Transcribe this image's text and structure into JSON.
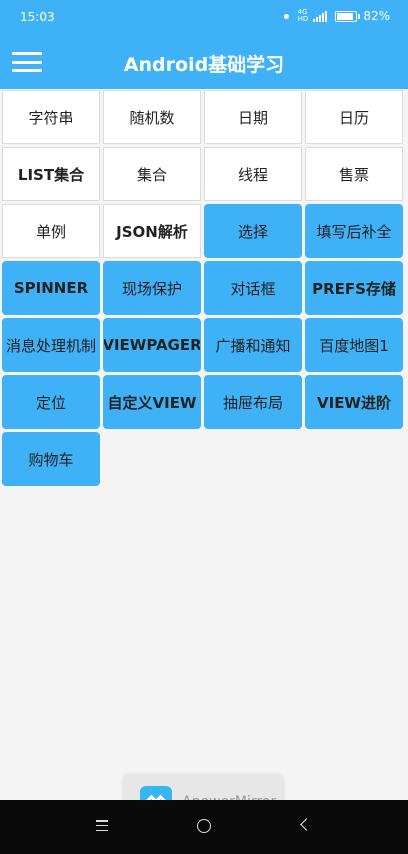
{
  "status_bar": {
    "time": "15:03",
    "network": "4G",
    "hd": "HD",
    "battery_level": "82%",
    "icons": [
      "notification-dot-icon",
      "signal-icon",
      "battery-icon"
    ]
  },
  "app_bar": {
    "title": "Android基础学习",
    "menu_icon": "hamburger-menu-icon",
    "color": "#3fb2f7"
  },
  "grid": {
    "rows": [
      [
        {
          "label": "字符串",
          "style": "white"
        },
        {
          "label": "随机数",
          "style": "white"
        },
        {
          "label": "日期",
          "style": "white"
        },
        {
          "label": "日历",
          "style": "white"
        }
      ],
      [
        {
          "label": "LIST集合",
          "style": "white"
        },
        {
          "label": "集合",
          "style": "white"
        },
        {
          "label": "线程",
          "style": "white"
        },
        {
          "label": "售票",
          "style": "white"
        }
      ],
      [
        {
          "label": "单例",
          "style": "white"
        },
        {
          "label": "JSON解析",
          "style": "white"
        },
        {
          "label": "选择",
          "style": "blue"
        },
        {
          "label": "填写后补全",
          "style": "blue"
        }
      ],
      [
        {
          "label": "SPINNER",
          "style": "blue"
        },
        {
          "label": "现场保护",
          "style": "blue"
        },
        {
          "label": "对话框",
          "style": "blue"
        },
        {
          "label": "PREFS存储",
          "style": "blue"
        }
      ],
      [
        {
          "label": "消息处理机制",
          "style": "blue"
        },
        {
          "label": "VIEWPAGER",
          "style": "blue"
        },
        {
          "label": "广播和通知",
          "style": "blue"
        },
        {
          "label": "百度地图1",
          "style": "blue"
        }
      ],
      [
        {
          "label": "定位",
          "style": "blue"
        },
        {
          "label": "自定义VIEW",
          "style": "blue"
        },
        {
          "label": "抽屉布局",
          "style": "blue"
        },
        {
          "label": "VIEW进阶",
          "style": "blue"
        }
      ],
      [
        {
          "label": "购物车",
          "style": "blue"
        }
      ]
    ]
  },
  "toast": {
    "app_name": "ApowerMirror",
    "logo_icon": "apowermirror-logo-icon"
  },
  "nav_bar": {
    "icons": [
      "recents-menu-icon",
      "home-circle-icon",
      "back-arrow-icon"
    ]
  }
}
